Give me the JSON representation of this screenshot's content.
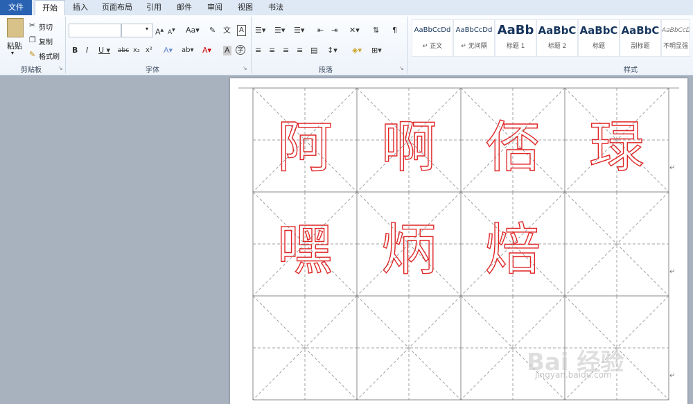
{
  "tabs": [
    "文件",
    "开始",
    "插入",
    "页面布局",
    "引用",
    "邮件",
    "审阅",
    "视图",
    "书法"
  ],
  "clipboard": {
    "paste": "粘贴",
    "cut": "剪切",
    "copy": "复制",
    "format_painter": "格式刷",
    "label": "剪贴板"
  },
  "font": {
    "label": "字体"
  },
  "paragraph": {
    "label": "段落"
  },
  "styles": {
    "label": "样式",
    "items": [
      {
        "sample": "AaBbCcDd",
        "name": "↵ 正文"
      },
      {
        "sample": "AaBbCcDd",
        "name": "↵ 无间隔"
      },
      {
        "sample": "AaBb",
        "name": "标题 1"
      },
      {
        "sample": "AaBbC",
        "name": "标题 2"
      },
      {
        "sample": "AaBbC",
        "name": "标题"
      },
      {
        "sample": "AaBbC",
        "name": "副标题"
      },
      {
        "sample": "AaBbCcDd",
        "name": "不明显强"
      }
    ]
  },
  "document": {
    "row1": [
      "阿",
      "啊",
      "俖",
      "琭"
    ],
    "row2": [
      "嘿",
      "炳",
      "焙"
    ]
  },
  "watermark": {
    "brand": "Bai 经验",
    "url": "jingyan.baidu.com"
  }
}
